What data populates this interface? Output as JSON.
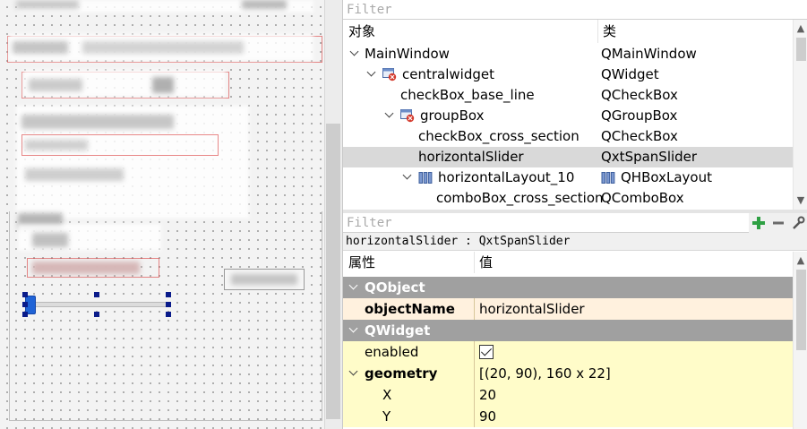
{
  "object_inspector": {
    "filter_placeholder": "Filter",
    "col_object": "对象",
    "col_class": "类",
    "rows": [
      {
        "name": "MainWindow",
        "class": "QMainWindow",
        "expanded": true,
        "icon": "none"
      },
      {
        "name": "centralwidget",
        "class": "QWidget",
        "expanded": true,
        "icon": "widget-form-icon"
      },
      {
        "name": "checkBox_base_line",
        "class": "QCheckBox",
        "icon": "none"
      },
      {
        "name": "groupBox",
        "class": "QGroupBox",
        "expanded": true,
        "icon": "widget-form-icon"
      },
      {
        "name": "checkBox_cross_section",
        "class": "QCheckBox",
        "icon": "none"
      },
      {
        "name": "horizontalSlider",
        "class": "QxtSpanSlider",
        "selected": true,
        "icon": "none"
      },
      {
        "name": "horizontalLayout_10",
        "class": "QHBoxLayout",
        "expanded": true,
        "icon": "hbox-layout-icon"
      },
      {
        "name": "comboBox_cross_section",
        "class": "QComboBox",
        "icon": "none"
      }
    ]
  },
  "property_editor": {
    "filter_placeholder": "Filter",
    "tools": {
      "add": "plus-icon",
      "remove": "minus-icon",
      "configure": "wrench-icon"
    },
    "selected_label": "horizontalSlider : QxtSpanSlider",
    "col_property": "属性",
    "col_value": "值",
    "groups": {
      "qobject": "QObject",
      "qwidget": "QWidget"
    },
    "props": {
      "objectName": {
        "key": "objectName",
        "value": "horizontalSlider"
      },
      "enabled": {
        "key": "enabled",
        "checked": true
      },
      "geometry": {
        "key": "geometry",
        "value": "[(20, 90), 160 x 22]"
      },
      "x": {
        "key": "X",
        "value": "20"
      },
      "y": {
        "key": "Y",
        "value": "90"
      }
    }
  },
  "colors": {
    "group_header": "#a0a0a0",
    "selected_row": "#d9d9d9",
    "qobject_row": "#fff1de",
    "qwidget_row": "#fffcc9",
    "slider_handle": "#1f63d6",
    "selection_handles": "#0a1b8a"
  }
}
